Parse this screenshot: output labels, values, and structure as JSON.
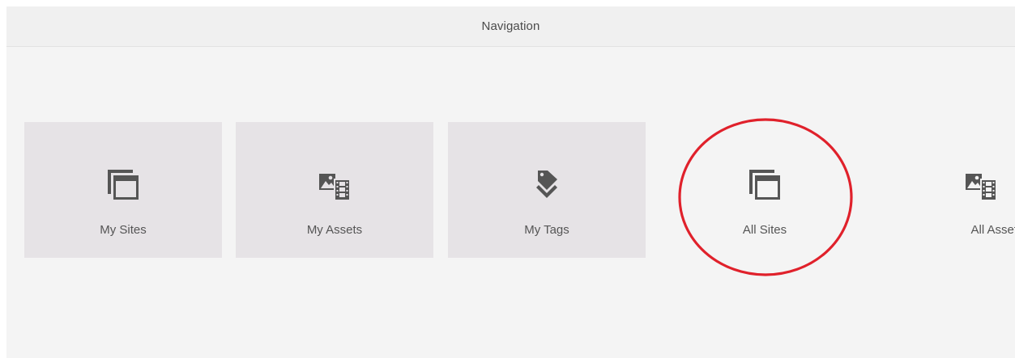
{
  "header": {
    "title": "Navigation"
  },
  "tiles": [
    {
      "label": "My Sites",
      "icon": "sites-icon"
    },
    {
      "label": "My Assets",
      "icon": "assets-icon"
    },
    {
      "label": "My Tags",
      "icon": "tags-icon"
    },
    {
      "label": "All Sites",
      "icon": "sites-icon"
    },
    {
      "label": "All Assets",
      "icon": "assets-icon"
    }
  ],
  "colors": {
    "tile_background": "#e6e3e6",
    "icon": "#555555",
    "annotation": "#e0212b"
  }
}
